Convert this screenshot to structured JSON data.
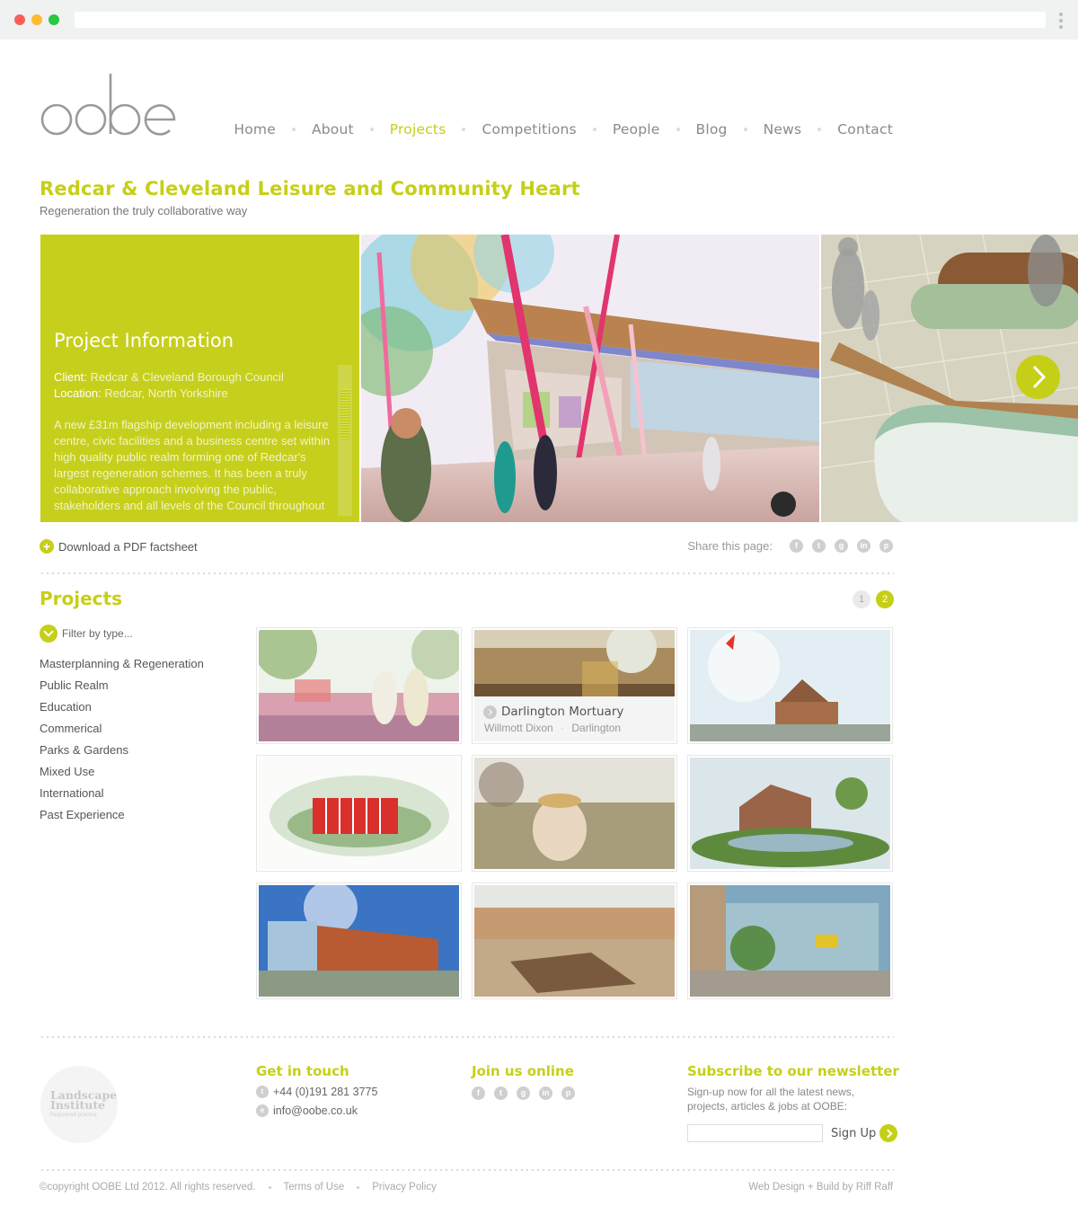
{
  "logo": {
    "text": "oobe"
  },
  "nav": {
    "items": [
      {
        "label": "Home"
      },
      {
        "label": "About"
      },
      {
        "label": "Projects",
        "active": true
      },
      {
        "label": "Competitions"
      },
      {
        "label": "People"
      },
      {
        "label": "Blog"
      },
      {
        "label": "News"
      },
      {
        "label": "Contact"
      }
    ]
  },
  "page": {
    "title": "Redcar & Cleveland Leisure and Community Heart",
    "subtitle": "Regeneration the truly collaborative way"
  },
  "project_info": {
    "heading": "Project Information",
    "client_label": "Client:",
    "client_value": "Redcar & Cleveland Borough Council",
    "location_label": "Location:",
    "location_value": "Redcar, North Yorkshire",
    "description": "A new £31m flagship development including a leisure centre, civic facilities and a business centre set within high quality public realm forming one of Redcar's largest regeneration schemes. It has been a truly collaborative approach involving the public, stakeholders and all levels of the Council throughout"
  },
  "download": {
    "label": "Download a PDF factsheet"
  },
  "share": {
    "label": "Share this page:",
    "icons": [
      "facebook-icon",
      "twitter-icon",
      "google-plus-icon",
      "linkedin-icon",
      "pinterest-icon"
    ]
  },
  "projects": {
    "heading": "Projects",
    "pages": [
      "1",
      "2"
    ],
    "current_page": "2",
    "filter_label": "Filter by type...",
    "categories": [
      "Masterplanning & Regeneration",
      "Public Realm",
      "Education",
      "Commerical",
      "Parks & Gardens",
      "Mixed Use",
      "International",
      "Past Experience"
    ],
    "featured_caption": {
      "title": "Darlington Mortuary",
      "client": "Willmott Dixon",
      "location": "Darlington"
    }
  },
  "footer": {
    "accreditation": {
      "line1": "Landscape",
      "line2": "Institute",
      "line3": "Registered practice"
    },
    "contact": {
      "heading": "Get in touch",
      "phone": "+44 (0)191 281 3775",
      "email": "info@oobe.co.uk"
    },
    "social": {
      "heading": "Join us online"
    },
    "newsletter": {
      "heading": "Subscribe to our newsletter",
      "text": "Sign-up now for all the latest news, projects, articles & jobs at OOBE:",
      "button": "Sign Up"
    },
    "copyright": "©copyright OOBE Ltd 2012. All rights reserved.",
    "terms": "Terms of Use",
    "privacy": "Privacy Policy",
    "credit": "Web Design + Build by Riff Raff"
  },
  "colors": {
    "accent": "#c6cf17",
    "text": "#555555",
    "muted": "#aaaaaa"
  }
}
